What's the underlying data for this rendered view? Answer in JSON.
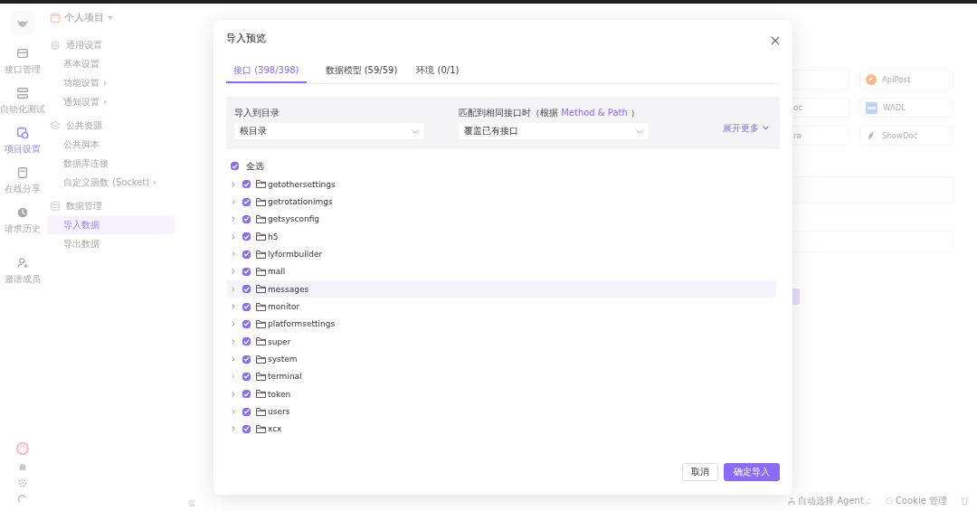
{
  "rail": {
    "items": [
      {
        "label": "接口管理",
        "selected": false
      },
      {
        "label": "自动化测试",
        "selected": false
      },
      {
        "label": "项目设置",
        "selected": true
      },
      {
        "label": "在线分享",
        "selected": false
      },
      {
        "label": "请求历史",
        "selected": false
      },
      {
        "label": "邀请成员",
        "selected": false
      }
    ]
  },
  "project": {
    "title": "个人项目"
  },
  "settings_menu": {
    "groups": [
      {
        "title": "通用设置",
        "items": [
          {
            "label": "基本设置",
            "selected": false,
            "submenu": false
          },
          {
            "label": "功能设置",
            "selected": false,
            "submenu": true
          },
          {
            "label": "通知设置",
            "selected": false,
            "submenu": true
          }
        ]
      },
      {
        "title": "公共资源",
        "items": [
          {
            "label": "公共脚本",
            "selected": false,
            "submenu": false
          },
          {
            "label": "数据库连接",
            "selected": false,
            "submenu": false
          },
          {
            "label": "自定义函数",
            "note": "(Socket)",
            "selected": false,
            "submenu": true
          }
        ]
      },
      {
        "title": "数据管理",
        "items": [
          {
            "label": "导入数据",
            "selected": true,
            "submenu": false
          },
          {
            "label": "导出数据",
            "selected": false,
            "submenu": false
          }
        ]
      }
    ]
  },
  "import_formats": [
    {
      "label": "ApiPost"
    },
    {
      "label": "oc"
    },
    {
      "label": "WADL"
    },
    {
      "label": "ra"
    },
    {
      "label": "ShowDoc"
    }
  ],
  "status_bar": {
    "agent": "自动选择 Agent",
    "cookie": "Cookie 管理"
  },
  "dialog": {
    "title": "导入预览",
    "tabs": [
      {
        "label": "接口 (398/398)",
        "selected": true
      },
      {
        "label": "数据模型 (59/59)",
        "selected": false
      },
      {
        "label": "环境 (0/1)",
        "selected": false
      }
    ],
    "target_folder": {
      "label": "导入到目录",
      "value": "根目录"
    },
    "on_match": {
      "label": "匹配到相同接口时（根据",
      "link": "Method & Path",
      "label_end": "）",
      "value": "覆盖已有接口"
    },
    "expand_more": "展开更多",
    "select_all": {
      "label": "全选",
      "checked": true
    },
    "folders": [
      {
        "name": "getothersettings",
        "checked": true,
        "selected": false
      },
      {
        "name": "getrotationimgs",
        "checked": true,
        "selected": false
      },
      {
        "name": "getsysconfig",
        "checked": true,
        "selected": false
      },
      {
        "name": "h5",
        "checked": true,
        "selected": false
      },
      {
        "name": "lyformbuilder",
        "checked": true,
        "selected": false
      },
      {
        "name": "mall",
        "checked": true,
        "selected": false
      },
      {
        "name": "messages",
        "checked": true,
        "selected": true
      },
      {
        "name": "monitor",
        "checked": true,
        "selected": false
      },
      {
        "name": "platformsettings",
        "checked": true,
        "selected": false
      },
      {
        "name": "super",
        "checked": true,
        "selected": false
      },
      {
        "name": "system",
        "checked": true,
        "selected": false
      },
      {
        "name": "terminal",
        "checked": true,
        "selected": false
      },
      {
        "name": "token",
        "checked": true,
        "selected": false
      },
      {
        "name": "users",
        "checked": true,
        "selected": false
      },
      {
        "name": "xcx",
        "checked": true,
        "selected": false
      }
    ],
    "buttons": [
      "取消",
      "确定导入"
    ]
  }
}
